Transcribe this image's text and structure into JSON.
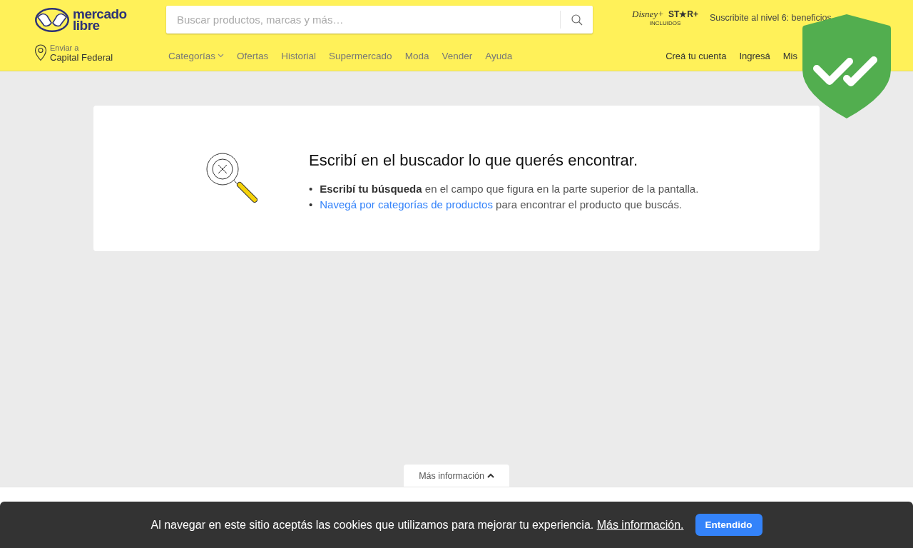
{
  "header": {
    "logo": {
      "line_1": "mercado",
      "line_2": "libre"
    },
    "search": {
      "placeholder": "Buscar productos, marcas y más…"
    },
    "promo": {
      "brand_1": "Disney+",
      "brand_2": "ST★R+",
      "caption": "INCLUIDOS",
      "text": "Suscribite al nivel 6: beneficios"
    },
    "location": {
      "label": "Enviar a",
      "value": "Capital Federal"
    },
    "nav": [
      {
        "label": "Categorías",
        "kind": "dropdown"
      },
      {
        "label": "Ofertas",
        "kind": "link"
      },
      {
        "label": "Historial",
        "kind": "link"
      },
      {
        "label": "Supermercado",
        "kind": "link"
      },
      {
        "label": "Moda",
        "kind": "link"
      },
      {
        "label": "Vender",
        "kind": "link"
      },
      {
        "label": "Ayuda",
        "kind": "link"
      }
    ],
    "account": [
      "Creá tu cuenta",
      "Ingresá",
      "Mis"
    ]
  },
  "empty_state": {
    "title": "Escribí en el buscador lo que querés encontrar.",
    "tips": [
      {
        "kind": "text",
        "marker": "•",
        "text": "**Escribí tu búsqueda** en el campo que figura en la parte superior de la pantalla."
      },
      {
        "kind": "link",
        "marker": "•",
        "link": "Navegá por categorías de productos",
        "text": "para encontrar el producto que buscás."
      }
    ]
  },
  "footer": {
    "toggle": "Más información"
  },
  "cookie_banner": {
    "text": "Al navegar en este sitio aceptás las cookies que utilizamos para mejorar tu experiencia.",
    "link": "Más información.",
    "button": "Entendido"
  }
}
